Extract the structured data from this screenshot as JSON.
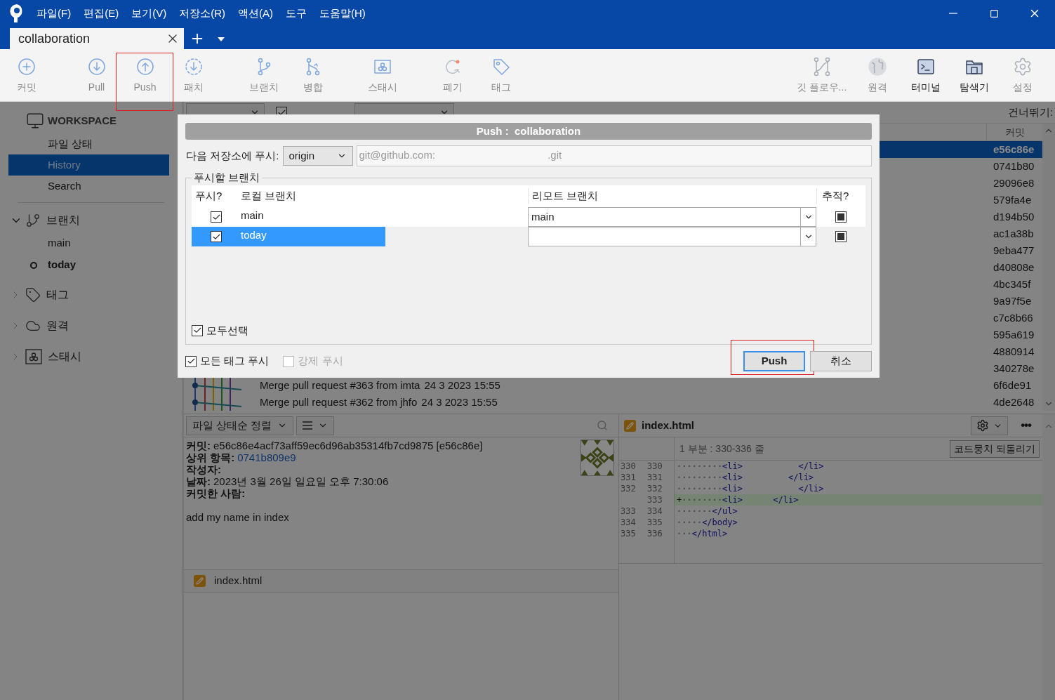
{
  "window": {
    "menus": [
      "파일(F)",
      "편집(E)",
      "보기(V)",
      "저장소(R)",
      "액션(A)",
      "도구",
      "도움말(H)"
    ]
  },
  "tabs": [
    {
      "label": "collaboration",
      "selected": true
    }
  ],
  "toolbar": {
    "left": [
      {
        "kind": "commit",
        "label": "커밋",
        "disabled": true,
        "highlighted": false
      },
      {
        "kind": "pull",
        "label": "Pull",
        "disabled": true,
        "highlighted": false
      },
      {
        "kind": "push",
        "label": "Push",
        "disabled": true,
        "highlighted": true
      },
      {
        "kind": "fetch",
        "label": "패치",
        "disabled": true,
        "highlighted": false
      },
      {
        "kind": "branch",
        "label": "브랜치",
        "disabled": true,
        "highlighted": false
      },
      {
        "kind": "merge",
        "label": "병합",
        "disabled": true,
        "highlighted": false
      },
      {
        "kind": "stash",
        "label": "스태시",
        "disabled": true,
        "highlighted": false
      },
      {
        "kind": "discard",
        "label": "폐기",
        "disabled": true,
        "highlighted": false
      },
      {
        "kind": "tag",
        "label": "태그",
        "disabled": true,
        "highlighted": false
      }
    ],
    "right": [
      {
        "kind": "gitflow",
        "label": "깃 플로우...",
        "disabled": true,
        "highlighted": false
      },
      {
        "kind": "remote",
        "label": "원격",
        "disabled": true,
        "highlighted": false
      },
      {
        "kind": "terminal",
        "label": "터미널",
        "disabled": false,
        "highlighted": false
      },
      {
        "kind": "explorer",
        "label": "탐색기",
        "disabled": false,
        "highlighted": false
      },
      {
        "kind": "settings",
        "label": "설정",
        "disabled": true,
        "highlighted": false
      }
    ]
  },
  "sidebar": {
    "workspace": {
      "title": "WORKSPACE",
      "items": [
        {
          "label": "파일 상태",
          "selected": false
        },
        {
          "label": "History",
          "selected": true
        },
        {
          "label": "Search",
          "selected": false
        }
      ]
    },
    "sections": [
      {
        "kind": "branch",
        "label": "브랜치",
        "expanded": true,
        "children": [
          {
            "label": "main",
            "current": false
          },
          {
            "label": "today",
            "current": true
          }
        ]
      },
      {
        "kind": "tag",
        "label": "태그",
        "expanded": false
      },
      {
        "kind": "remote",
        "label": "원격",
        "expanded": false
      },
      {
        "kind": "stash",
        "label": "스태시",
        "expanded": false
      }
    ]
  },
  "filter_bar": {
    "remote_branches": {
      "checked": true
    },
    "jump_label": "건너뛰기:"
  },
  "commit_list": {
    "hash_header": "커밋",
    "rows": [
      {
        "hash": "e56c86e",
        "selected": true
      },
      {
        "hash": "0741b80",
        "selected": false
      },
      {
        "hash": "29096e8",
        "selected": false
      },
      {
        "hash": "579fa4e",
        "selected": false
      },
      {
        "hash": "d194b50",
        "selected": false
      },
      {
        "hash": "ac1a38b",
        "selected": false
      },
      {
        "hash": "9eba477",
        "selected": false
      },
      {
        "hash": "d40808e",
        "selected": false
      },
      {
        "hash": "4bc345f",
        "selected": false
      },
      {
        "hash": "9a97f5e",
        "selected": false
      },
      {
        "hash": "c7c8b66",
        "selected": false
      },
      {
        "hash": "595a619",
        "selected": false
      },
      {
        "hash": "4880914",
        "selected": false
      },
      {
        "hash": "340278e",
        "selected": false
      },
      {
        "message": "Merge pull request #363 from imta",
        "date": "24 3 2023 15:55",
        "hash": "6f6de91",
        "selected": false
      },
      {
        "message": "Merge pull request #362 from jhfo",
        "date": "24 3 2023 15:55",
        "hash": "4de2648",
        "selected": false
      }
    ]
  },
  "file_pane": {
    "sort": "파일 상태순 정렬",
    "details": [
      {
        "label": "커밋:",
        "value": "e56c86e4acf73aff59ec6d96ab35314fb7cd9875 [e56c86e]"
      },
      {
        "label": "상위 항목:",
        "link": "0741b809e9"
      },
      {
        "label": "작성자:"
      },
      {
        "label": "날짜:",
        "value": "2023년 3월 26일 일요일 오후 7:30:06"
      },
      {
        "label": "커밋한 사람:"
      }
    ],
    "message": "add my name in index",
    "files": [
      {
        "name": "index.html"
      }
    ]
  },
  "diff_pane": {
    "file": {
      "name": "index.html"
    },
    "more": "•••",
    "hunk_title": "1 부분 : 330-336 줄",
    "revert_button": "코드뭉치 되돌리기",
    "lines": [
      {
        "kind": "context",
        "old": "330",
        "new": "330",
        "indent": "·········",
        "code": "<li>           </li>"
      },
      {
        "kind": "context",
        "old": "331",
        "new": "331",
        "indent": "·········",
        "code": "<li>         </li>"
      },
      {
        "kind": "context",
        "old": "332",
        "new": "332",
        "indent": "·········",
        "code": "<li>           </li>"
      },
      {
        "kind": "added",
        "new": "333",
        "marker": "+",
        "indent": "········",
        "code": "<li>      </li>"
      },
      {
        "kind": "context",
        "old": "333",
        "new": "334",
        "indent": "·······",
        "code": "</ul>"
      },
      {
        "kind": "context",
        "old": "334",
        "new": "335",
        "indent": "·····",
        "code": "</body>"
      },
      {
        "kind": "context",
        "old": "335",
        "new": "336",
        "indent": "···",
        "code": "</html>"
      }
    ]
  },
  "dialog": {
    "title": "Push :  collaboration",
    "remote_label": "다음 저장소에 푸시:",
    "remote": "origin",
    "url_start": "git@github.com:",
    "url_end": ".git",
    "group_label": "푸시할 브랜치",
    "columns": [
      "푸시?",
      "로컬 브랜치",
      "리모트 브랜치",
      "추적?"
    ],
    "branches": [
      {
        "local": "main",
        "push": true,
        "remote": "main",
        "track": true,
        "selected": false
      },
      {
        "local": "today",
        "push": true,
        "track": true,
        "selected": true
      }
    ],
    "select_all": {
      "label": "모두선택",
      "checked": true
    },
    "options": [
      {
        "label": "모든 태그 푸시",
        "checked": true,
        "disabled": false
      },
      {
        "label": "강제 푸시",
        "checked": false,
        "disabled": true
      }
    ],
    "buttons": [
      {
        "label": "Push",
        "kind": "primary",
        "highlighted": true
      },
      {
        "label": "취소",
        "kind": "secondary"
      }
    ]
  }
}
